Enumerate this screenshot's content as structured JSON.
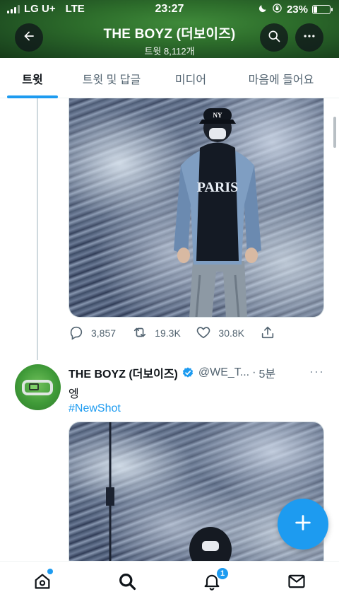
{
  "status_bar": {
    "carrier": "LG U+",
    "network": "LTE",
    "time": "23:27",
    "battery": "23%",
    "battery_level": 0.23
  },
  "header": {
    "title": "THE BOYZ (더보이즈)",
    "subtitle": "트윗 8,112개",
    "back_icon": "arrow-left-icon",
    "search_icon": "search-icon",
    "more_icon": "more-horizontal-icon"
  },
  "tabs": [
    {
      "label": "트윗",
      "active": true
    },
    {
      "label": "트윗 및 답글",
      "active": false
    },
    {
      "label": "미디어",
      "active": false
    },
    {
      "label": "마음에 들어요",
      "active": false
    }
  ],
  "tweet1": {
    "replies": "3,857",
    "retweets": "19.3K",
    "likes": "30.8K"
  },
  "tweet2": {
    "name": "THE BOYZ (더보이즈)",
    "handle": "@WE_T...",
    "dot": "·",
    "time": "5분",
    "more": "···",
    "text": "엥",
    "hashtag": "#NewShot"
  },
  "bottom_nav": {
    "items": [
      {
        "icon": "home-icon",
        "badge_dot": true
      },
      {
        "icon": "search-icon",
        "active": true
      },
      {
        "icon": "notifications-icon",
        "badge_count": "1"
      },
      {
        "icon": "messages-icon"
      }
    ]
  },
  "colors": {
    "accent": "#1d9bf0",
    "header_green": "#2d6d2b",
    "secondary_text": "#536471"
  }
}
